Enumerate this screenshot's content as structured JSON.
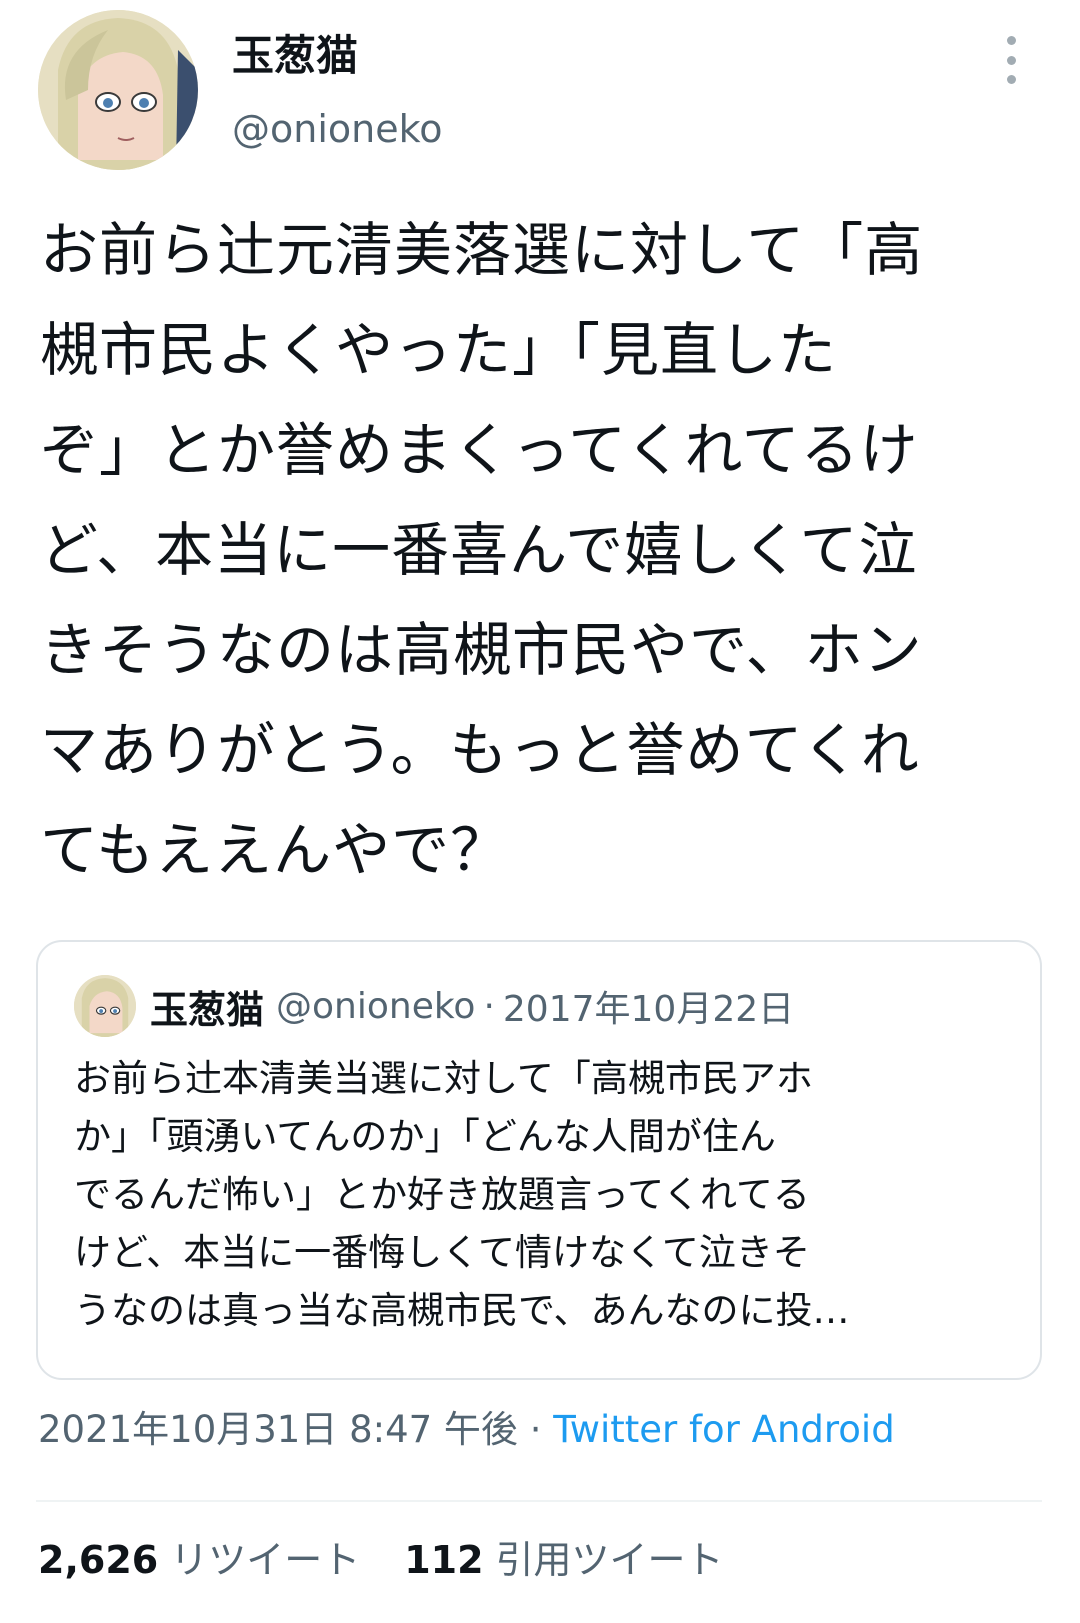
{
  "tweet": {
    "display_name": "玉葱猫",
    "handle": "@onioneko",
    "text": "お前ら辻元清美落選に対して「高\n槻市民よくやった」「見直した\nぞ」とか誉めまくってくれてるけ\nど、本当に一番喜んで嬉しくて泣\nきそうなのは高槻市民やで、ホン\nマありがとう。もっと誉めてくれ\nてもええんやで？",
    "timestamp": "2021年10月31日 8:47 午後",
    "separator": "·",
    "source": "Twitter for Android"
  },
  "quote": {
    "display_name": "玉葱猫",
    "handle": "@onioneko",
    "separator": "·",
    "date": "2017年10月22日",
    "text": "お前ら辻本清美当選に対して「高槻市民アホ\nか」「頭湧いてんのか」「どんな人間が住ん\nでるんだ怖い」とか好き放題言ってくれてる\nけど、本当に一番悔しくて情けなくて泣きそ\nうなのは真っ当な高槻市民で、あんなのに投…"
  },
  "stats": {
    "retweets": {
      "count": "2,626",
      "label": "リツイート"
    },
    "quotes": {
      "count": "112",
      "label": "引用ツイート"
    }
  },
  "colors": {
    "text_primary": "#0f1419",
    "text_secondary": "#536471",
    "link": "#1d9bf0",
    "border": "#dfe4e8"
  },
  "icons": {
    "avatar": "anime-character-avatar",
    "more": "more-vertical-icon"
  }
}
